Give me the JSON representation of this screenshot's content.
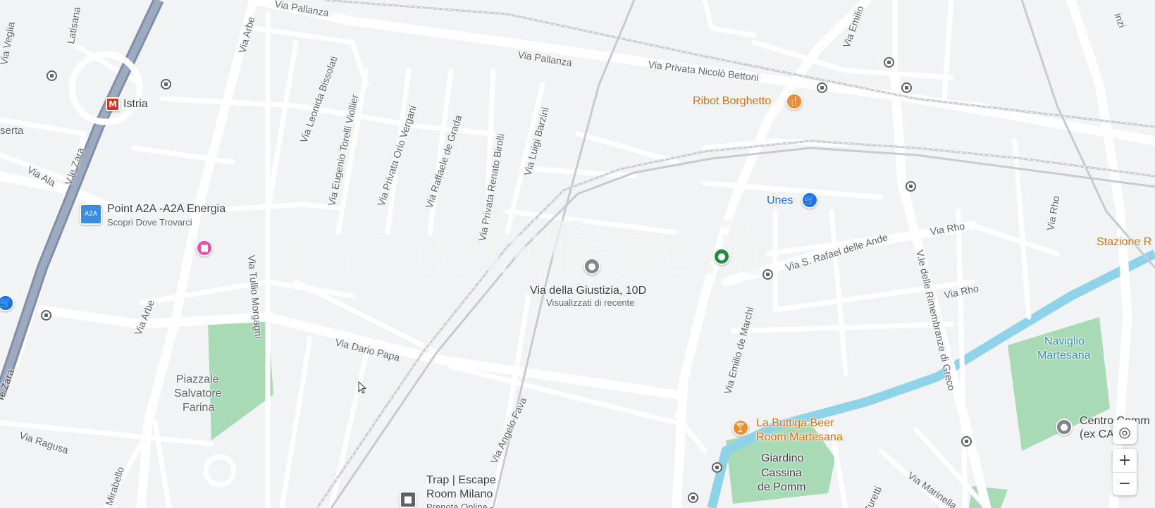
{
  "streets": {
    "via_pallanza_top": "Via Pallanza",
    "via_pallanza": "Via Pallanza",
    "via_privata_bettoni": "Via Privata Nicolò Bettoni",
    "via_emilio_top": "Via Emilio",
    "latisana": "Latisana",
    "via_veglia": "Via Veglia",
    "via_arbe_top": "Via Arbe",
    "via_leonida": "Via Leonida Bissolati",
    "via_eugenio": "Via Eugenio Torelli Viollier",
    "via_orio": "Via Privata Orio Vergani",
    "via_raffaele": "Via Raffaele de Grada",
    "via_renato": "Via Privata Renato Birolli",
    "via_luigi": "Via Luigi Barzini",
    "via_tullio": "Via Tullio Morgagni",
    "vle_zara": "V.le Zara",
    "via_ala": "Via Ala",
    "serta": "serta",
    "via_arbe_bottom": "Via Arbe",
    "via_dario": "Via Dario Papa",
    "via_ragusa": "Via Ragusa",
    "mirabello": "Mirabello",
    "via_angelo": "Via Angelo Fava",
    "via_emilio_marchi": "Via Emilio de Marchi",
    "via_rafael": "Via S. Rafael delle Ande",
    "via_rho_1": "Via Rho",
    "via_rho_2": "Via Rho",
    "via_rho_3": "Via Rho",
    "vle_rimembranze": "V.le delle Rimembranze di Greco",
    "via_marinella": "Via Marinella",
    "zuretti": "Zuretti",
    "vle_zara_bottom": "le Zara",
    "inzi": "inzi"
  },
  "pois": {
    "istria": "Istria",
    "metro_letter": "M",
    "a2a_name": "Point A2A -A2A Energia",
    "a2a_sub": "Scopri Dove Trovarci",
    "a2a_logo": "A2A",
    "ribot": "Ribot Borghetto",
    "unes": "Unes",
    "stazione": "Stazione R",
    "selected_name": "Via della Giustizia, 10D",
    "selected_sub": "Visualizzati di recente",
    "naviglio_line1": "Naviglio",
    "naviglio_line2": "Martesana",
    "piazzale_line1": "Piazzale",
    "piazzale_line2": "Salvatore",
    "piazzale_line3": "Farina",
    "buttiga_line1": "La Buttiga Beer",
    "buttiga_line2": "Room Martesana",
    "giardino_line1": "Giardino",
    "giardino_line2": "Cassina",
    "giardino_line3": "de Pomm",
    "centro_line1": "Centro Comm",
    "centro_line2": "(ex CA",
    "trap_line1": "Trap | Escape",
    "trap_line2": "Room Milano",
    "trap_line3": "Prenota Online -"
  },
  "watermark": "immobiliare.it",
  "controls": {
    "zoom_in": "+",
    "zoom_out": "−",
    "location": "◎"
  },
  "colors": {
    "road": "#ffffff",
    "road_edge": "#dadce0",
    "highway": "#8a9bb5",
    "water": "#8fd3e8",
    "park": "#a8dab5",
    "orange_poi": "#f08c2a",
    "blue_poi": "#1a73e8",
    "green_poi": "#1e8e3e",
    "pink_poi": "#e94fa8",
    "metro_red": "#d93025"
  }
}
